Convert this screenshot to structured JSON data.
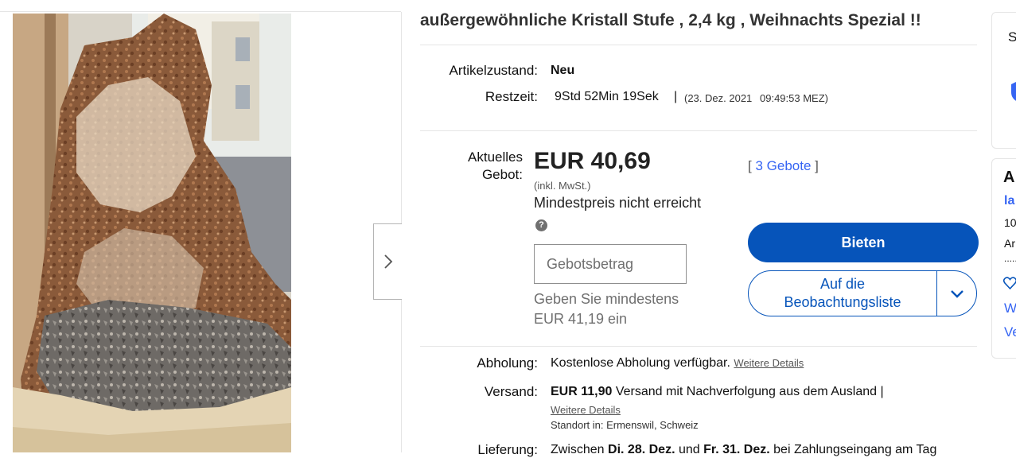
{
  "listing": {
    "title": "außergewöhnliche Kristall Stufe , 2,4 kg , Weihnachts Spezial !!"
  },
  "condition": {
    "label": "Artikelzustand:",
    "value": "Neu"
  },
  "time_left": {
    "label": "Restzeit:",
    "value": "9Std 52Min 19Sek",
    "separator": "|",
    "end_date": "(23. Dez. 2021",
    "end_time": "09:49:53 MEZ)"
  },
  "bid": {
    "label_line1": "Aktuelles",
    "label_line2": "Gebot:",
    "price": "EUR 40,69",
    "tax_note": "(inkl. MwSt.)",
    "reserve": "Mindestpreis nicht erreicht",
    "help_glyph": "?",
    "bid_count_open": "[",
    "bid_count_link": "3 Gebote",
    "bid_count_close": "]",
    "input_placeholder": "Gebotsbetrag",
    "min_line1": "Geben Sie mindestens",
    "min_line2": "EUR 41,19 ein",
    "bid_button": "Bieten",
    "watch_line1": "Auf die",
    "watch_line2": "Beobachtungsliste"
  },
  "pickup": {
    "label": "Abholung:",
    "value": "Kostenlose Abholung verfügbar.",
    "link": "Weitere Details"
  },
  "shipping": {
    "label": "Versand:",
    "price": "EUR 11,90",
    "text": "Versand mit Nachverfolgung aus dem Ausland |",
    "link": "Weitere Details",
    "location": "Standort in:  Ermenswil, Schweiz"
  },
  "delivery": {
    "label": "Lieferung:",
    "text_prefix": "Zwischen ",
    "date_from": "Di. 28. Dez.",
    "and": " und ",
    "date_to": "Fr. 31. Dez.",
    "text_suffix": " bei Zahlungseingang am Tag"
  },
  "right_cards": {
    "card1_letter": "S",
    "card2_title": "A",
    "card2_link": "la",
    "card2_num": "10",
    "card2_line": "Ar",
    "card2_dots": "......",
    "card2_w": "W",
    "card2_v": "Ve"
  },
  "colors": {
    "primary": "#0654ba",
    "link": "#3665f3"
  }
}
